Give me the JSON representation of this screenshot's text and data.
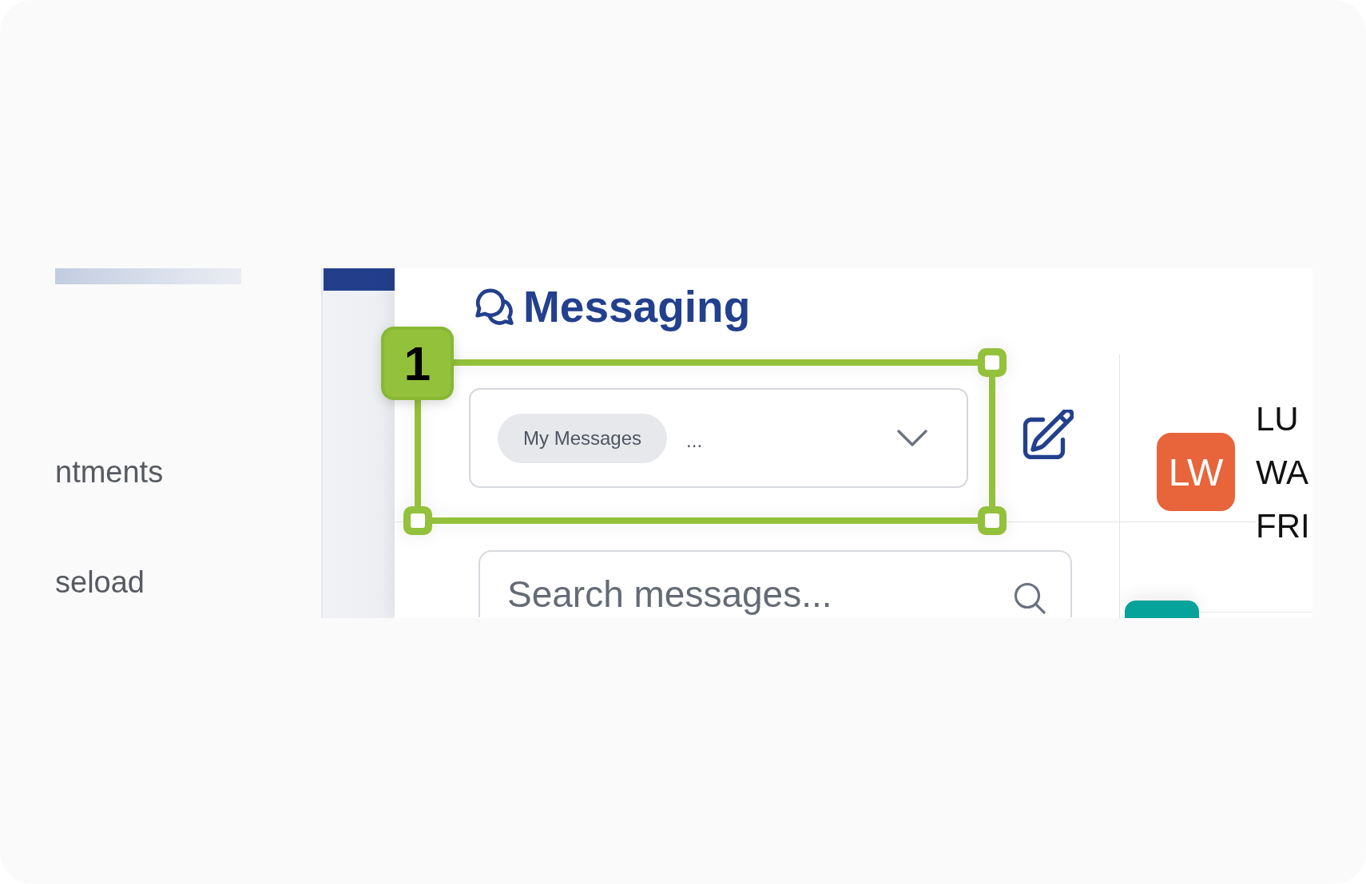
{
  "sidebar": {
    "items": [
      {
        "label": "ntments"
      },
      {
        "label": "seload"
      }
    ]
  },
  "messaging": {
    "title": "Messaging",
    "filter": {
      "chip": "My Messages",
      "overflow": "..."
    },
    "search": {
      "placeholder": "Search messages..."
    }
  },
  "conversations": [
    {
      "initials": "LW",
      "color": "#e8643a",
      "lines": [
        "LU",
        "WA",
        "FRI"
      ]
    },
    {
      "color": "#06a39a"
    }
  ],
  "annotation": {
    "step": "1"
  }
}
